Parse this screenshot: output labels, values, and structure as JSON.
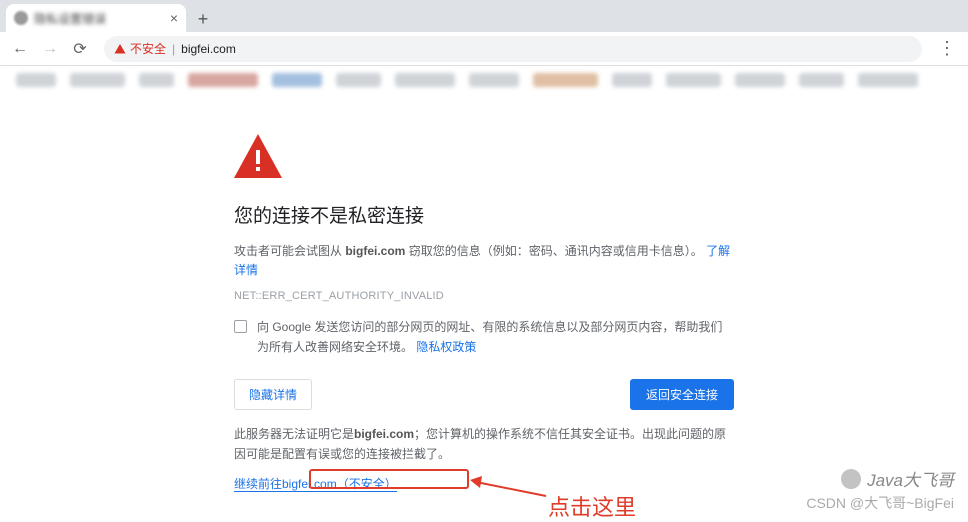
{
  "tab": {
    "title": "隐私设置错误"
  },
  "toolbar": {
    "not_secure": "不安全",
    "url": "bigfei.com"
  },
  "warning": {
    "headline": "您的连接不是私密连接",
    "para1_prefix": "攻击者可能会试图从 ",
    "domain": "bigfei.com",
    "para1_suffix": " 窃取您的信息（例如：密码、通讯内容或信用卡信息）。",
    "learn_more": "了解详情",
    "error_code": "NET::ERR_CERT_AUTHORITY_INVALID",
    "opt_text_prefix": "向 Google 发送您访问的部分网页的网址、有限的系统信息以及部分网页内容，帮助我们为所有人改善网络安全环境。",
    "opt_policy": "隐私权政策",
    "hide_details": "隐藏详情",
    "back_to_safety": "返回安全连接",
    "expl_prefix": "此服务器无法证明它是",
    "expl_mid": "；您计算机的操作系统不信任其安全证书。出现此问题的原因可能是配置有误或您的连接被拦截了。",
    "proceed": "继续前往bigfei.com（不安全）"
  },
  "annotation": {
    "label": "点击这里"
  },
  "watermark": {
    "line1": "Java大飞哥",
    "line2": "CSDN @大飞哥~BigFei"
  }
}
